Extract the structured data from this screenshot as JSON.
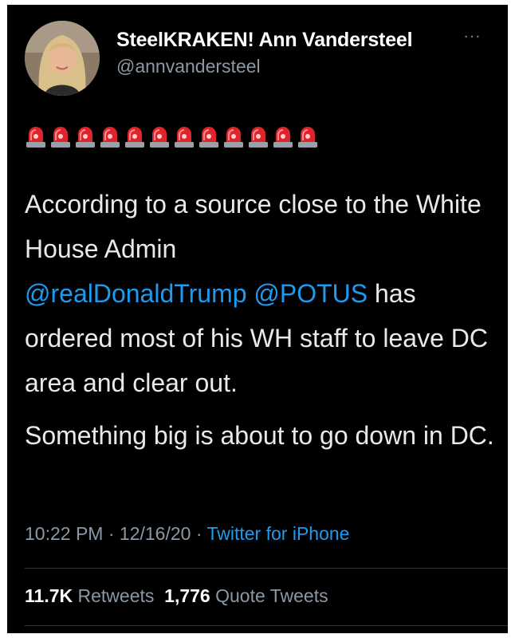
{
  "user": {
    "display_name": "SteelKRAKEN! Ann Vandersteel",
    "handle": "@annvandersteel",
    "avatar": "profile-photo"
  },
  "tweet": {
    "emoji_row": {
      "icon": "police-siren-emoji",
      "count": 12
    },
    "line1_text": "According to a source close to the White House Admin",
    "mention_1": "@realDonaldTrump",
    "mention_2": "@POTUS",
    "line1_tail": "has ordered most of his WH staff to leave DC area and clear out.",
    "paragraph_2": "Something big is about to go down in DC."
  },
  "meta": {
    "time": "10:22 PM",
    "separator": "·",
    "date": "12/16/20",
    "source": "Twitter for iPhone"
  },
  "stats": {
    "retweets_count": "11.7K",
    "retweets_label": "Retweets",
    "quote_count": "1,776",
    "quote_label": "Quote Tweets"
  },
  "colors": {
    "background": "#000000",
    "text": "#e7e9ea",
    "secondary": "#8b98a5",
    "link": "#1d9bf0",
    "divider": "#2f3336"
  }
}
